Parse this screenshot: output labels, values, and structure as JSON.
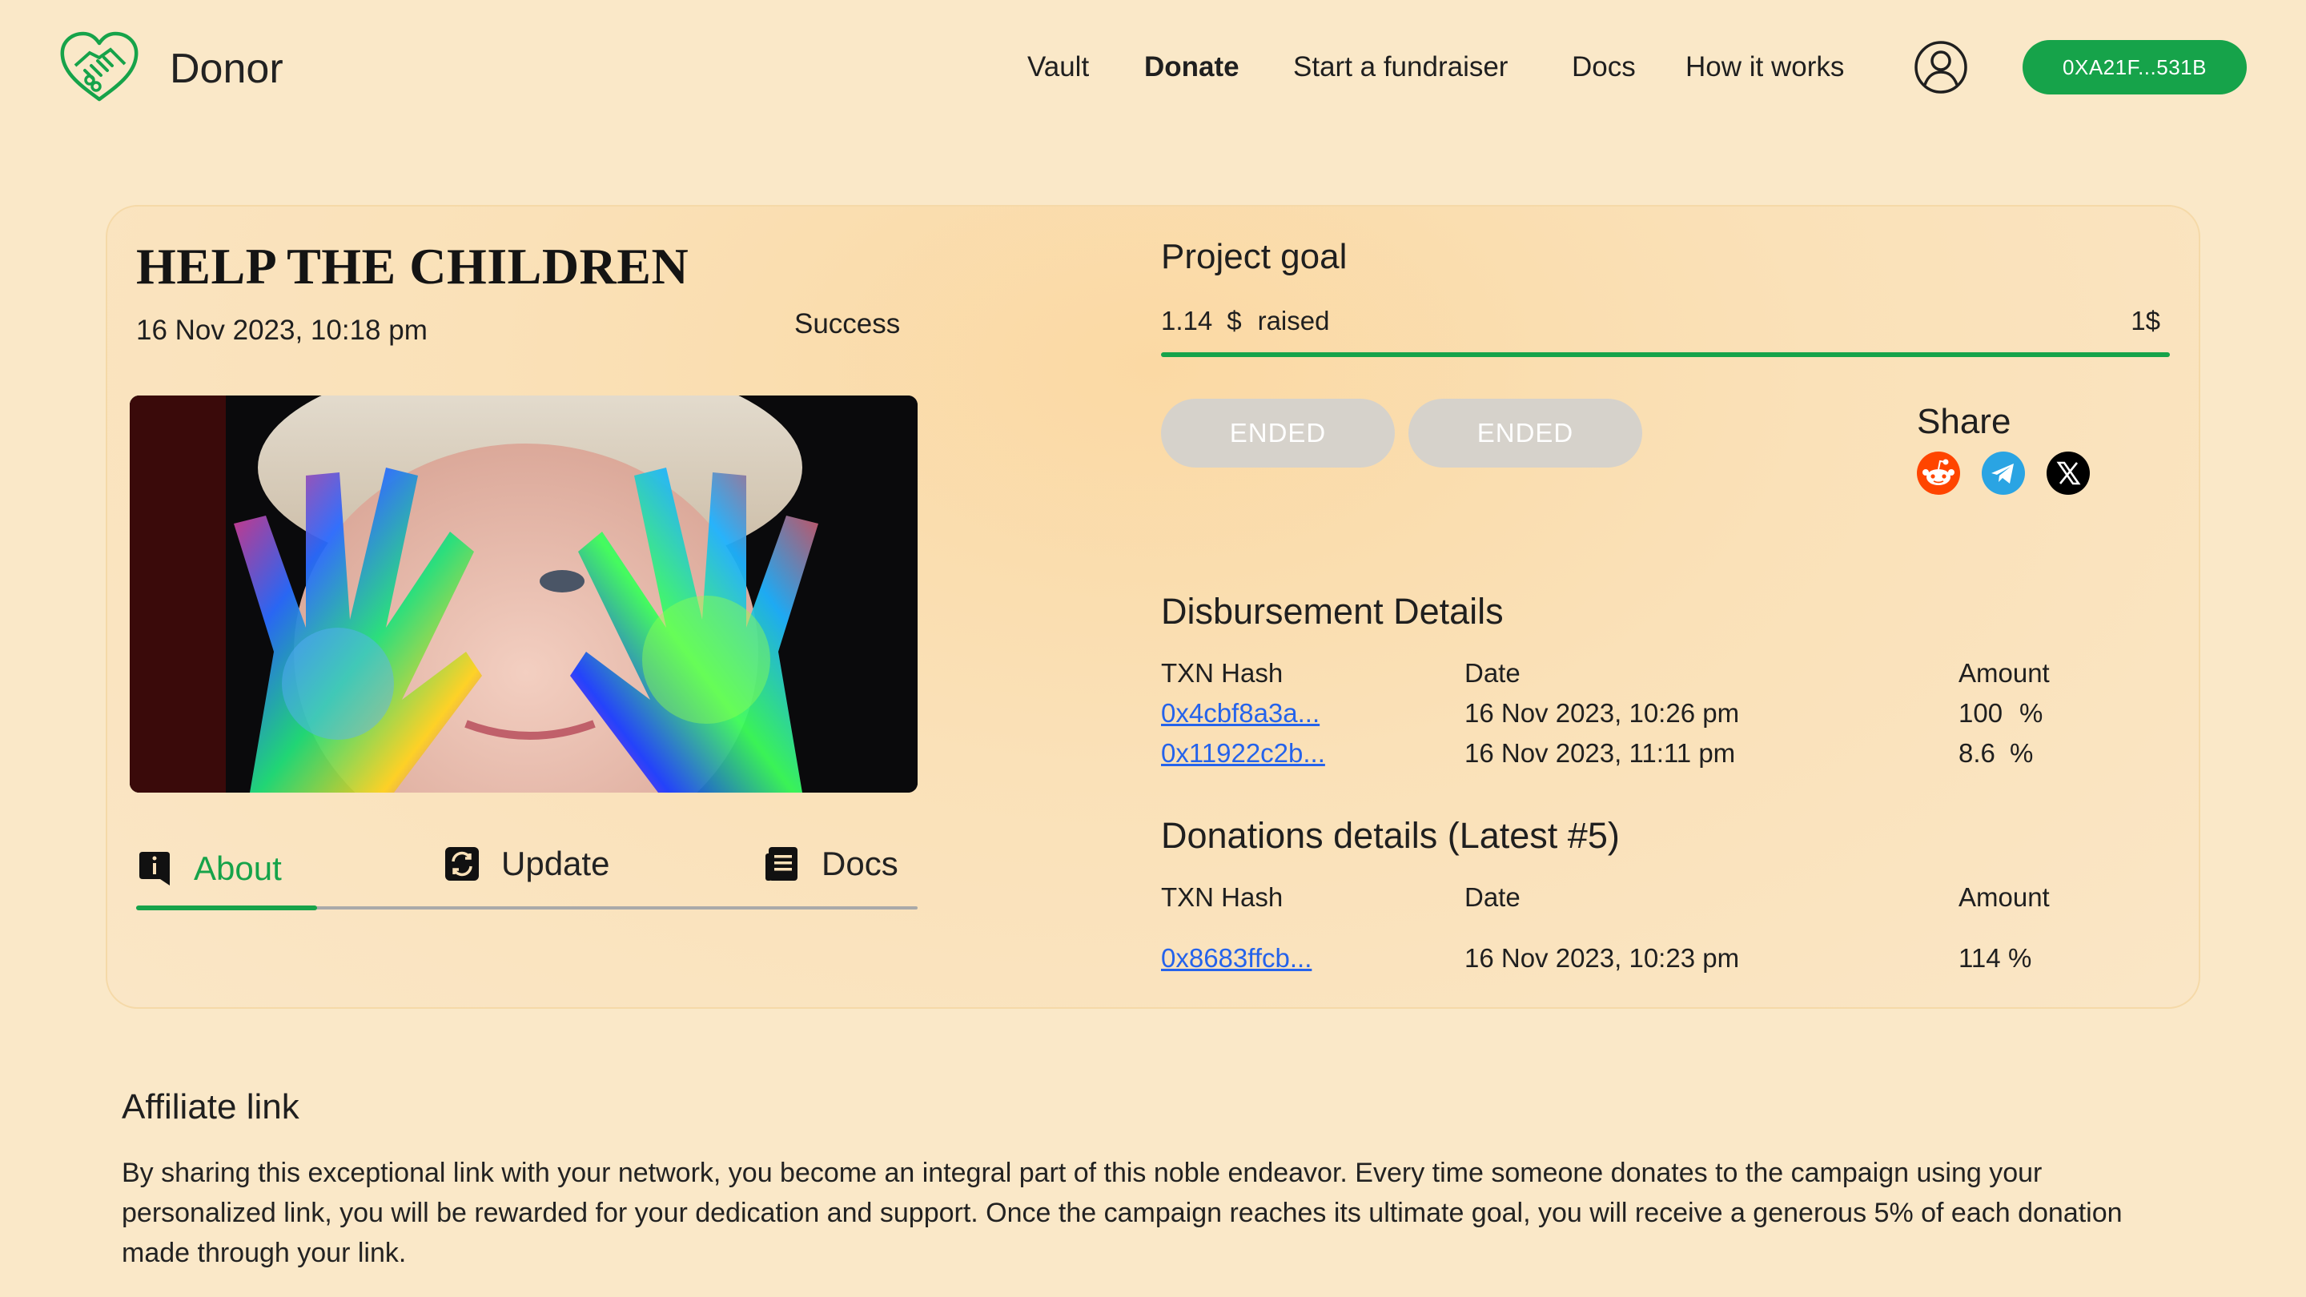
{
  "brand": {
    "name": "Donor",
    "logo_icon": "handshake-heart-icon",
    "accent": "#16a34a"
  },
  "nav": {
    "items": [
      "Vault",
      "Donate",
      "Start a fundraiser",
      "Docs",
      "How it works"
    ],
    "active": "Donate",
    "user_icon": "user-circle-icon",
    "wallet_label": "0XA21F...531B"
  },
  "campaign": {
    "title": "HELP THE CHILDREN",
    "created": "16 Nov 2023, 10:18 pm",
    "status": "Success",
    "image": "child-with-paint-covered-hands",
    "tabs": [
      {
        "label": "About",
        "icon": "info-icon",
        "active": true
      },
      {
        "label": "Update",
        "icon": "refresh-icon",
        "active": false
      },
      {
        "label": "Docs",
        "icon": "document-icon",
        "active": false
      }
    ]
  },
  "goal": {
    "title": "Project goal",
    "raised_value": "1.14",
    "raised_currency": "$",
    "raised_label": "raised",
    "target": "1$",
    "progress_fraction": 1.0
  },
  "actions": {
    "buttons": [
      "ENDED",
      "ENDED"
    ]
  },
  "share": {
    "label": "Share",
    "icons": [
      "reddit-icon",
      "telegram-icon",
      "x-icon"
    ],
    "colors": {
      "reddit": "#ff4500",
      "telegram": "#2aa4e3",
      "x": "#000000"
    }
  },
  "disbursement": {
    "title": "Disbursement Details",
    "headers": [
      "TXN Hash",
      "Date",
      "Amount"
    ],
    "rows": [
      {
        "hash": "0x4cbf8a3a...",
        "date": "16 Nov 2023, 10:26 pm",
        "amount": "100",
        "unit": "%"
      },
      {
        "hash": "0x11922c2b...",
        "date": "16 Nov 2023, 11:11 pm",
        "amount": "8.6",
        "unit": "%"
      }
    ]
  },
  "donations": {
    "title": "Donations details (Latest #5)",
    "headers": [
      "TXN Hash",
      "Date",
      "Amount"
    ],
    "rows": [
      {
        "hash": "0x8683ffcb...",
        "date": "16 Nov 2023, 10:23 pm",
        "amount": "114",
        "unit": "%"
      }
    ]
  },
  "affiliate": {
    "title": "Affiliate link",
    "text": "By sharing this exceptional link with your network, you become an integral part of this noble endeavor. Every time someone donates to the campaign using your personalized link, you will be rewarded for your dedication and support. Once the campaign reaches its ultimate goal, you will receive a generous 5% of each donation made through your link."
  }
}
